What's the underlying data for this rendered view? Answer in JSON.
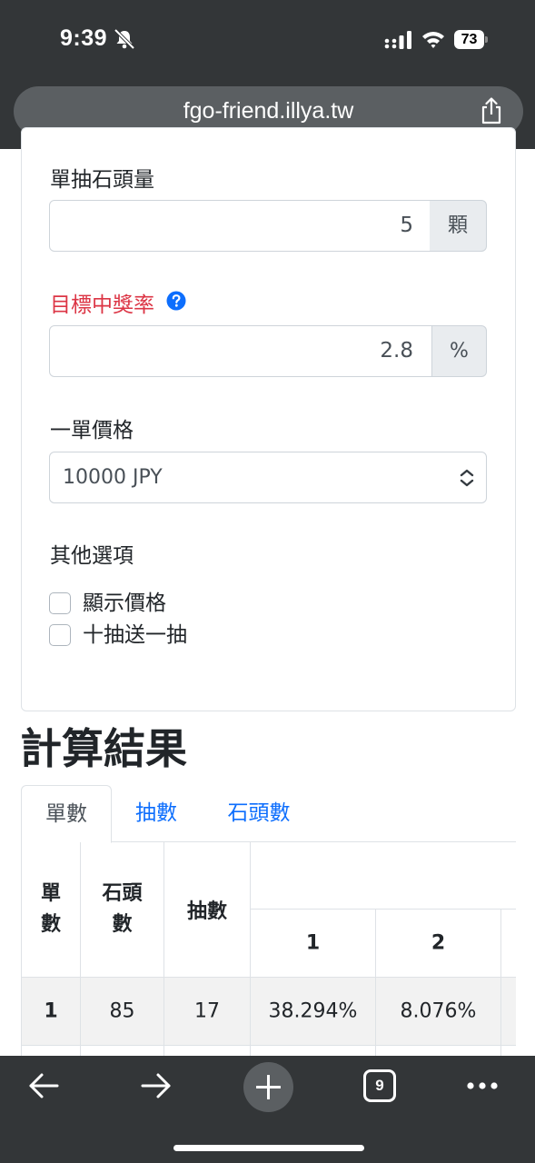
{
  "status_bar": {
    "time": "9:39",
    "battery": "73"
  },
  "browser": {
    "url": "fgo-friend.illya.tw",
    "tab_count": "9"
  },
  "form": {
    "stones_per_pull": {
      "label": "單抽石頭量",
      "value": "5",
      "unit": "顆"
    },
    "target_rate": {
      "label": "目標中獎率",
      "value": "2.8",
      "unit": "%"
    },
    "price": {
      "label": "一單價格",
      "selected": "10000 JPY"
    },
    "options": {
      "label": "其他選項",
      "show_price": "顯示價格",
      "ten_plus_one": "十抽送一抽"
    }
  },
  "results": {
    "heading": "計算結果",
    "tabs": [
      {
        "label": "單數"
      },
      {
        "label": "抽數"
      },
      {
        "label": "石頭數"
      }
    ],
    "columns": {
      "orders": "單數",
      "stones": "石頭數",
      "pulls": "抽數",
      "c1": "1",
      "c2": "2"
    },
    "rows": [
      {
        "orders": "1",
        "stones": "85",
        "pulls": "17",
        "c1": "38.294%",
        "c2": "8.076%"
      }
    ]
  },
  "colors": {
    "chrome": "#333638",
    "url_bar": "#5b5f62",
    "link": "#0d6efd",
    "danger": "#dc3545",
    "addon": "#e9ecef",
    "row_shade": "#f2f2f2"
  },
  "icons": {
    "status": [
      "bell-slash-icon",
      "signal-icon",
      "wifi-icon",
      "battery-icon"
    ],
    "browser": [
      "share-icon",
      "back-icon",
      "forward-icon",
      "plus-icon",
      "tabs-icon",
      "more-icon"
    ],
    "form": [
      "help-icon",
      "select-chevron-icon"
    ]
  }
}
